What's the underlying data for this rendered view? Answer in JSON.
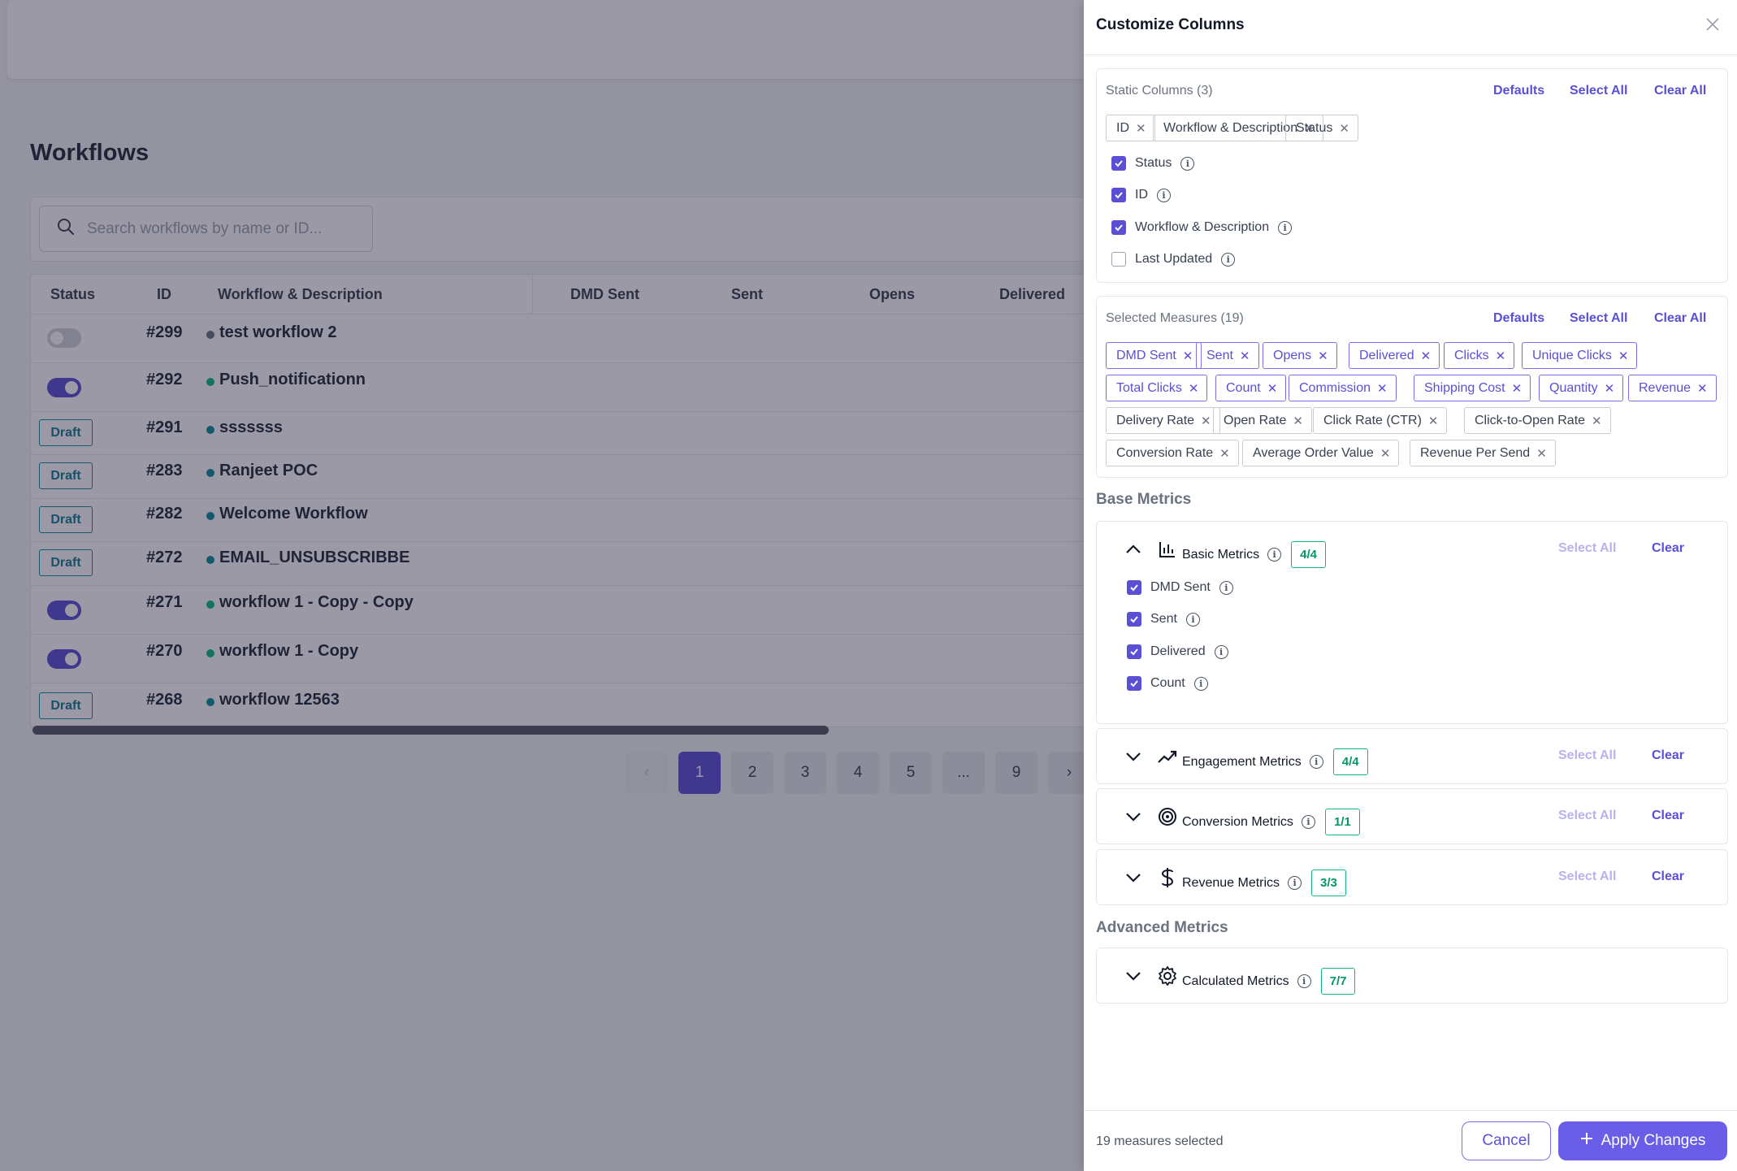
{
  "page": {
    "title": "Workflows",
    "search_placeholder": "Search workflows by name or ID..."
  },
  "table": {
    "headers": [
      "Status",
      "ID",
      "Workflow & Description",
      "DMD Sent",
      "Sent",
      "Opens",
      "Delivered"
    ],
    "rows": [
      {
        "status": "toggle-off",
        "id": "#299",
        "name": "test workflow 2",
        "dot_color": "#6b7280"
      },
      {
        "status": "toggle-on",
        "id": "#292",
        "name": "Push_notificationn",
        "dot_color": "#10b981"
      },
      {
        "status": "Draft",
        "id": "#291",
        "name": "sssssss",
        "dot_color": "#0e8a9c"
      },
      {
        "status": "Draft",
        "id": "#283",
        "name": "Ranjeet POC",
        "dot_color": "#0e8a9c"
      },
      {
        "status": "Draft",
        "id": "#282",
        "name": "Welcome Workflow",
        "dot_color": "#0e8a9c"
      },
      {
        "status": "Draft",
        "id": "#272",
        "name": "EMAIL_UNSUBSCRIBBE",
        "dot_color": "#0e8a9c"
      },
      {
        "status": "toggle-on",
        "id": "#271",
        "name": "workflow 1 - Copy - Copy",
        "dot_color": "#10b981"
      },
      {
        "status": "toggle-on",
        "id": "#270",
        "name": "workflow 1 - Copy",
        "dot_color": "#10b981"
      },
      {
        "status": "Draft",
        "id": "#268",
        "name": "workflow 12563",
        "dot_color": "#0e8a9c"
      }
    ]
  },
  "pagination": {
    "pages": [
      "1",
      "2",
      "3",
      "4",
      "5",
      "...",
      "9"
    ],
    "current": "1"
  },
  "drawer": {
    "title": "Customize Columns",
    "static": {
      "label": "Static Columns (3)",
      "defaults": "Defaults",
      "select_all": "Select All",
      "clear_all": "Clear All",
      "chips": [
        "ID",
        "Workflow & Description",
        "Status"
      ],
      "options": [
        {
          "label": "Status",
          "checked": true
        },
        {
          "label": "ID",
          "checked": true
        },
        {
          "label": "Workflow & Description",
          "checked": true
        },
        {
          "label": "Last Updated",
          "checked": false
        }
      ]
    },
    "measures": {
      "label": "Selected Measures (19)",
      "defaults": "Defaults",
      "select_all": "Select All",
      "clear_all": "Clear All",
      "chips": [
        "DMD Sent",
        "Sent",
        "Opens",
        "Delivered",
        "Clicks",
        "Unique Clicks",
        "Total Clicks",
        "Count",
        "Commission",
        "Shipping Cost",
        "Quantity",
        "Revenue",
        "Delivery Rate",
        "Open Rate",
        "Click Rate (CTR)",
        "Click-to-Open Rate",
        "Conversion Rate",
        "Average Order Value",
        "Revenue Per Send"
      ]
    },
    "base_metrics_title": "Base Metrics",
    "advanced_metrics_title": "Advanced Metrics",
    "groups": [
      {
        "name": "Basic Metrics",
        "badge": "4/4",
        "icon": "bar-chart-icon",
        "expanded": true,
        "items": [
          {
            "label": "DMD Sent",
            "checked": true
          },
          {
            "label": "Sent",
            "checked": true
          },
          {
            "label": "Delivered",
            "checked": true
          },
          {
            "label": "Count",
            "checked": true
          }
        ]
      },
      {
        "name": "Engagement Metrics",
        "badge": "4/4",
        "icon": "trending-up-icon",
        "expanded": false
      },
      {
        "name": "Conversion Metrics",
        "badge": "1/1",
        "icon": "target-icon",
        "expanded": false
      },
      {
        "name": "Revenue Metrics",
        "badge": "3/3",
        "icon": "dollar-icon",
        "expanded": false
      },
      {
        "name": "Calculated Metrics",
        "badge": "7/7",
        "icon": "gear-icon",
        "expanded": false
      }
    ],
    "group_select_all": "Select All",
    "group_clear": "Clear",
    "footer": {
      "summary": "19 measures selected",
      "cancel": "Cancel",
      "apply": "Apply Changes"
    }
  },
  "colors": {
    "accent": "#5b4fd6",
    "badge_green": "#10b981",
    "draft_teal": "#0e8a9c"
  }
}
